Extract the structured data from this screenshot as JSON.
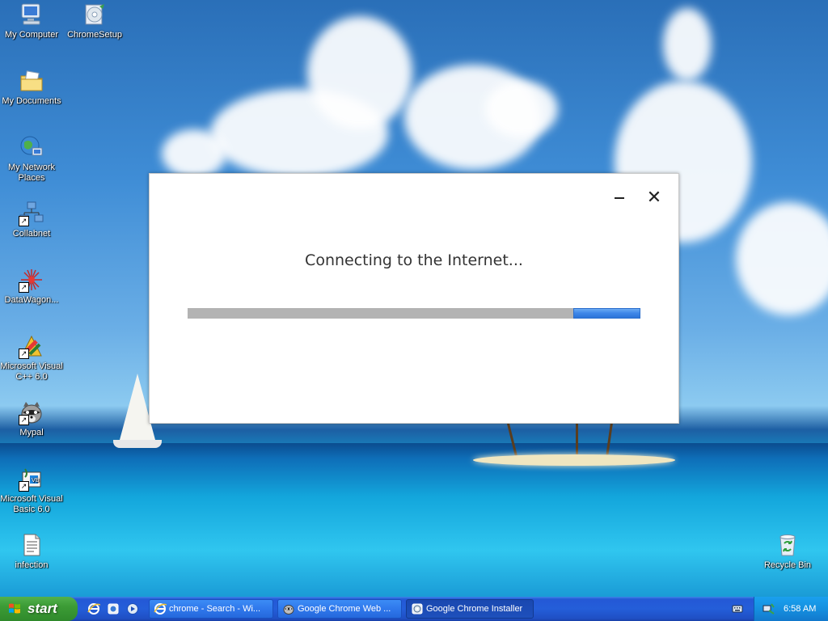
{
  "desktop": {
    "icons": [
      {
        "id": "my-computer",
        "label": "My Computer"
      },
      {
        "id": "chromesetup",
        "label": "ChromeSetup"
      },
      {
        "id": "my-documents",
        "label": "My Documents"
      },
      {
        "id": "my-network-places",
        "label": "My Network Places"
      },
      {
        "id": "collabnet",
        "label": "Collabnet"
      },
      {
        "id": "datawagon",
        "label": "DataWagon..."
      },
      {
        "id": "ms-visual-cpp",
        "label": "Microsoft Visual C++ 6.0"
      },
      {
        "id": "mypal",
        "label": "Mypal"
      },
      {
        "id": "ms-visual-basic",
        "label": "Microsoft Visual Basic 6.0"
      },
      {
        "id": "infection",
        "label": "infection"
      },
      {
        "id": "recycle-bin",
        "label": "Recycle Bin"
      }
    ]
  },
  "installer": {
    "status": "Connecting to the Internet...",
    "minimize_icon": "minimize-icon",
    "close_glyph": "✕",
    "progress": {
      "fill_start_pct": 85.2,
      "fill_end_pct": 100,
      "color": "#3d86e8"
    }
  },
  "taskbar": {
    "start_label": "start",
    "quick_launch": [
      "internet-explorer-icon",
      "chrome-setup-icon",
      "media-player-icon"
    ],
    "tasks": [
      {
        "label": "chrome - Search - Wi...",
        "icon": "internet-explorer-icon",
        "active": false
      },
      {
        "label": "Google Chrome Web ...",
        "icon": "mypal-raccoon-icon",
        "active": false
      },
      {
        "label": "Google Chrome Installer",
        "icon": "chrome-installer-icon",
        "active": true
      }
    ],
    "clock": "6:58 AM"
  },
  "colors": {
    "taskbar_blue": "#245ed9",
    "start_green": "#3c9b36",
    "progress_blue": "#3d86e8",
    "progress_track": "#b3b3b3"
  }
}
